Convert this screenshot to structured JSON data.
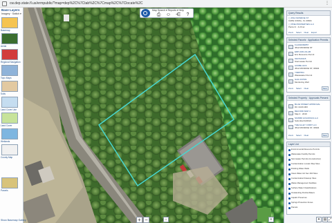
{
  "browser": {
    "url": "cw.dep.state.fl.us/ermpublic/?map=dep%2C%7Ctab%2C%7Cmap%2C%7Clocate%2C",
    "url_icon": "page-icon",
    "menu_icon": "kebab-menu-icon",
    "menu_glyph": "⋮"
  },
  "left_panel": {
    "title": "Base Layers",
    "subtitle": "Imagery · Switch ▾",
    "tiles": [
      {
        "label": "Basemap",
        "color": "#f5c451"
      },
      {
        "label": "Aerial",
        "color": "#3b6d2f"
      },
      {
        "label": "Regional Navigation",
        "color": "#d23c3c"
      },
      {
        "label": "Topo Maps",
        "color": "#8fb3d9"
      },
      {
        "label": "Soils",
        "color": "#e2c9a1"
      },
      {
        "label": "Land Cover Use",
        "color": "#c5ddf0"
      },
      {
        "label": "Land Cover",
        "color": "#c7e39a"
      },
      {
        "label": "Wetlands",
        "color": "#7eb6e0"
      },
      {
        "label": "County Map",
        "color": "#f1f1f1"
      },
      {
        "label": "Parcels",
        "color": "#d8c37a"
      }
    ],
    "bottom_link": "Show Basemap Gallery"
  },
  "toolbar": {
    "title": "Map Search ▾ Reports ▾ Help",
    "logo_icon": "dep-logo-icon",
    "buttons": [
      {
        "icon": "print-icon",
        "glyph": "⎙"
      },
      {
        "icon": "person-icon",
        "glyph": "☺"
      },
      {
        "icon": "share-icon",
        "glyph": "⋲"
      },
      {
        "icon": "help-icon",
        "glyph": "?"
      }
    ]
  },
  "right_panel": {
    "section1": {
      "header": "Query Results",
      "items": [
        {
          "line1": "▢ 4512 MONROE ST",
          "line2": "CAPE CORAL, FL 33904"
        },
        {
          "line1": "▢ PINE PROPERTIES LLC",
          "line2": "Parcel 4 · 4.23 ac"
        }
      ],
      "actions": [
        "Zoom",
        "Select",
        "Clear",
        "Export"
      ]
    },
    "section2": {
      "header": "Selected Parcels · Application Permits",
      "items": [
        {
          "line1": "FL1002384857",
          "line2": "4512 MONROE ST"
        },
        {
          "line1": "ERP-0234-19-AB",
          "line2": "Env Resource Permit"
        },
        {
          "line1": "0347220115",
          "line2": "Stormwater Permit"
        },
        {
          "line1": "ACKBE HGS",
          "line2": "4512 MONROE ST, 33904"
        },
        {
          "line1": "Y0987654",
          "line2": "Wastewater Permit"
        },
        {
          "line1": "GHG 337001",
          "line2": "Monitoring Well"
        }
      ],
      "actions": [
        "Zoom",
        "Select",
        "Clear"
      ],
      "save_label": "Save"
    },
    "section3": {
      "header": "Selected Property · Approvals Present",
      "items": [
        {
          "line1": "BLUE STREET APPROVAL",
          "line2": "DC 19-00-003"
        },
        {
          "line1": "RECORD MAP 4",
          "line2": "Map 4 · 2019"
        },
        {
          "line1": "SFWMD HOLDINGS LLC",
          "line2": "Submittal 04/2021"
        },
        {
          "line1": "THE ALLEY CORP LLC",
          "line2": "4512 MONROE ST, 33904"
        }
      ],
      "actions": [
        "Zoom",
        "Select",
        "Clear"
      ],
      "save_label": "Save"
    },
    "section4": {
      "header": "Layer List",
      "items": [
        "Environmental Resource Permits",
        "Wastewater Facility Permits",
        "Stormwater Permits (Construction)",
        "Contamination Locator Map Sites",
        "Drinking Water Wells",
        "Clean Water Act Sec 404 Sites",
        "Contamination/Cleanup Sites",
        "Waste Management Facilities",
        "Surface Water Classifications",
        "Outstanding Florida Waters",
        "Aquatic Preserves",
        "Springs Protection Zones",
        "Parcels"
      ]
    }
  },
  "map": {
    "zoom_in": "+",
    "zoom_out": "−",
    "polygon_color": "#47d8d1",
    "bottom_tools": [
      {
        "icon": "home-icon",
        "glyph": "⌂"
      },
      {
        "icon": "layers-icon",
        "glyph": "≡"
      }
    ],
    "bottom_right_tools": [
      {
        "icon": "compass-icon",
        "glyph": "✦"
      },
      {
        "icon": "legend-icon",
        "glyph": "▤"
      },
      {
        "icon": "expand-icon",
        "glyph": "⤢"
      }
    ]
  }
}
